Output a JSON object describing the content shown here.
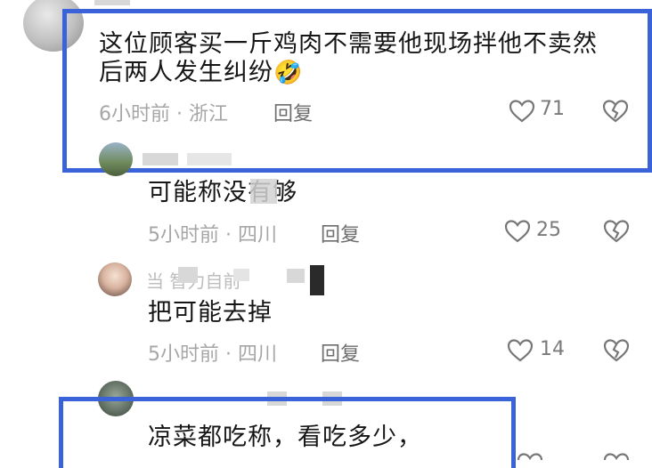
{
  "comments": [
    {
      "text_line1": "这位顾客买一斤鸡肉不需要他现场拌他不卖然",
      "text_line2": "后两人发生纠纷",
      "emoji": "🤣",
      "meta": "6小时前 · 浙江",
      "reply_label": "回复",
      "likes": "71"
    },
    {
      "text_line1": "可能称没有够",
      "meta": "5小时前 · 四川",
      "reply_label": "回复",
      "likes": "25"
    },
    {
      "username": "当                    智力自前",
      "text_line1": "把可能去掉",
      "meta": "5小时前 · 四川",
      "reply_label": "回复",
      "likes": "14"
    },
    {
      "text_line1": "凉菜都吃称，看吃多少，"
    }
  ],
  "colors": {
    "highlight_frame": "#3a63d9",
    "meta_text": "#a6a6a6",
    "reply_text": "#6e6e6e"
  },
  "icons": {
    "like": "heart-outline-icon",
    "dislike": "broken-heart-icon"
  }
}
